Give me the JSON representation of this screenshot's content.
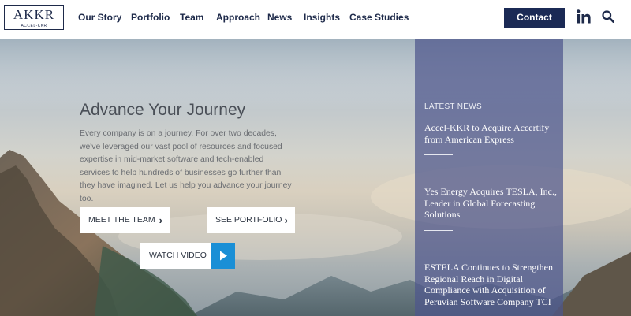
{
  "header": {
    "logo": {
      "main": "AKKR",
      "sub": "ACCEL-KKR"
    },
    "nav": [
      "Our Story",
      "Portfolio",
      "Team",
      "Approach",
      "News",
      "Insights",
      "Case Studies"
    ],
    "contact_label": "Contact",
    "icons": {
      "linkedin": "linkedin-icon",
      "search": "search-icon"
    }
  },
  "hero": {
    "title": "Advance Your Journey",
    "description": "Every company is on a journey. For over two decades, we've leveraged our vast pool of resources and focused expertise in mid-market software and tech-enabled services to help hundreds of businesses go further than they have imagined. Let us help you advance your journey too.",
    "buttons": {
      "team": "MEET THE TEAM",
      "portfolio": "SEE PORTFOLIO",
      "video": "WATCH VIDEO"
    }
  },
  "news": {
    "heading": "LATEST NEWS",
    "items": [
      "Accel-KKR to Acquire Accertify from American Express",
      "Yes Energy Acquires TESLA, Inc., Leader in Global Forecasting Solutions",
      "ESTELA Continues to Strengthen Regional Reach in Digital Compliance with Acquisition of Peruvian Software Company TCI"
    ]
  },
  "colors": {
    "navy": "#1b2a55",
    "play_blue": "#1a8fd6",
    "news_panel": "#4e568c"
  }
}
